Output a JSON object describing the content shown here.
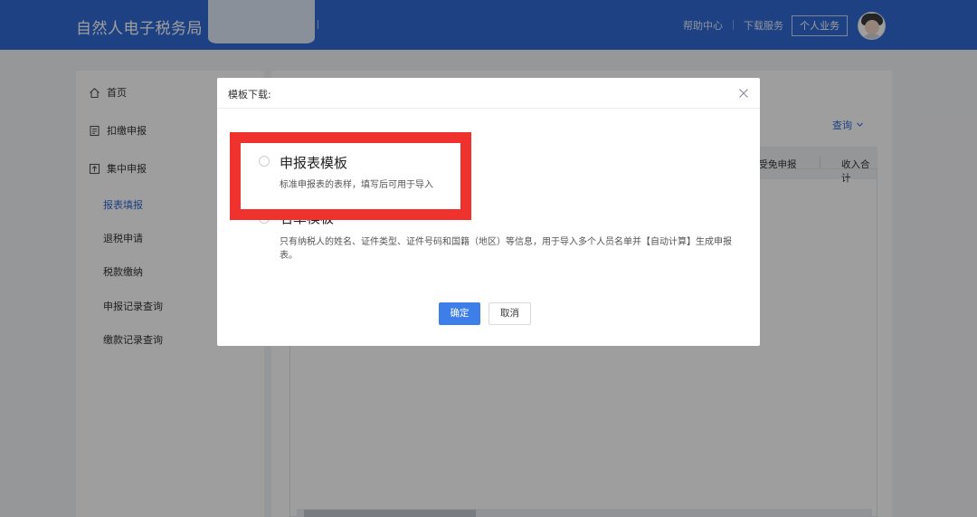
{
  "header": {
    "brand": "自然人电子税务局",
    "links": [
      "帮助中心",
      "下载服务"
    ],
    "personal_button": "个人业务"
  },
  "sidebar": {
    "items": [
      {
        "label": "首页",
        "icon": "home-icon"
      },
      {
        "label": "扣缴申报",
        "icon": "document-icon"
      },
      {
        "label": "集中申报",
        "icon": "upload-icon"
      }
    ],
    "sub_items": [
      {
        "label": "报表填报",
        "active": true
      },
      {
        "label": "退税申请",
        "active": false
      },
      {
        "label": "税款缴纳",
        "active": false
      },
      {
        "label": "申报记录查询",
        "active": false
      },
      {
        "label": "缴款记录查询",
        "active": false
      }
    ]
  },
  "content": {
    "query_link": "查询",
    "table_headers": [
      "享受免申报",
      "收入合计"
    ]
  },
  "dialog": {
    "title": "模板下载:",
    "options": [
      {
        "title": "申报表模板",
        "description": "标准申报表的表样，填写后可用于导入"
      },
      {
        "title": "名单模板",
        "description": "只有纳税人的姓名、证件类型、证件号码和国籍（地区）等信息，用于导入多个人员名单并【自动计算】生成申报表。"
      }
    ],
    "confirm_label": "确定",
    "cancel_label": "取消"
  },
  "colors": {
    "header_bg": "#2f6ad3",
    "primary": "#3d7ee8",
    "highlight": "#f0322e"
  }
}
